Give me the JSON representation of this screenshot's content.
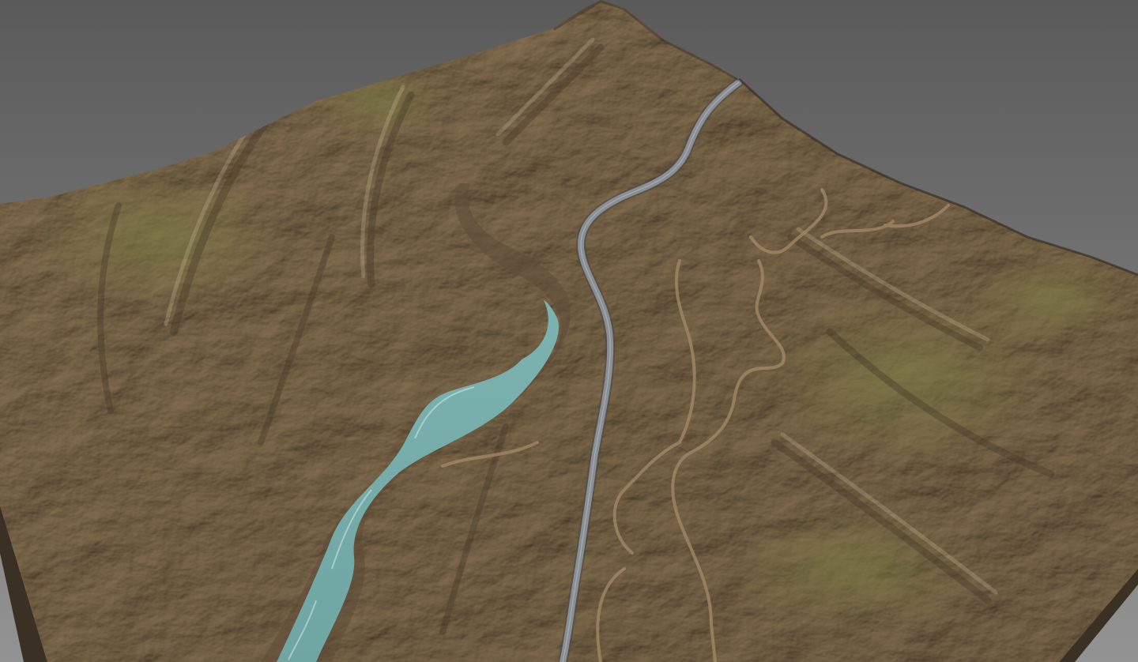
{
  "scene": {
    "subject": "3d-terrain-render",
    "has_visible_text": false
  },
  "colors": {
    "background_top": "#5a5a5a",
    "background_bottom": "#939393",
    "terrain_light": "#a38e6c",
    "terrain_mid": "#7f6b4e",
    "terrain_dark": "#4f4232",
    "moss_green": "#7f7d45",
    "river_water": "#6fa6a4",
    "road_asphalt": "#8a8f96",
    "dirt_track": "#9d8563"
  }
}
